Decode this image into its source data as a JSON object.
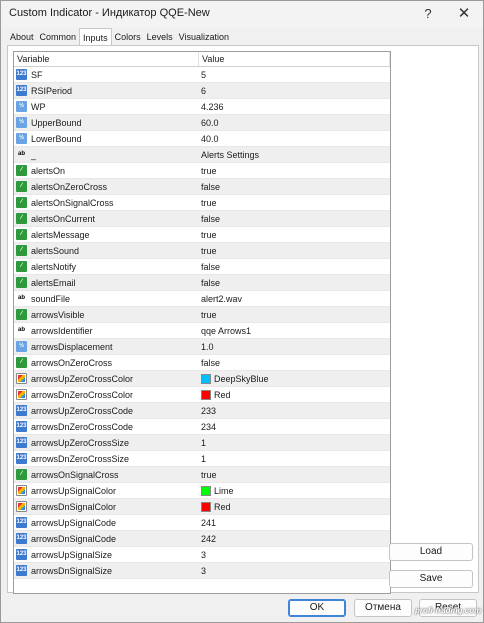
{
  "window": {
    "title": "Custom Indicator - Индикатор QQE-New",
    "help_label": "?",
    "close_label": "✕"
  },
  "tabs": [
    {
      "label": "About"
    },
    {
      "label": "Common"
    },
    {
      "label": "Inputs",
      "active": true
    },
    {
      "label": "Colors"
    },
    {
      "label": "Levels"
    },
    {
      "label": "Visualization"
    }
  ],
  "grid": {
    "headers": {
      "variable": "Variable",
      "value": "Value"
    },
    "rows": [
      {
        "name": "SF",
        "type": "int",
        "value": "5"
      },
      {
        "name": "RSIPeriod",
        "type": "int",
        "value": "6"
      },
      {
        "name": "WP",
        "type": "double",
        "value": "4.236"
      },
      {
        "name": "UpperBound",
        "type": "double",
        "value": "60.0"
      },
      {
        "name": "LowerBound",
        "type": "double",
        "value": "40.0"
      },
      {
        "name": "_",
        "type": "string",
        "value": "Alerts Settings"
      },
      {
        "name": "alertsOn",
        "type": "bool",
        "value": "true"
      },
      {
        "name": "alertsOnZeroCross",
        "type": "bool",
        "value": "false"
      },
      {
        "name": "alertsOnSignalCross",
        "type": "bool",
        "value": "true"
      },
      {
        "name": "alertsOnCurrent",
        "type": "bool",
        "value": "false"
      },
      {
        "name": "alertsMessage",
        "type": "bool",
        "value": "true"
      },
      {
        "name": "alertsSound",
        "type": "bool",
        "value": "true"
      },
      {
        "name": "alertsNotify",
        "type": "bool",
        "value": "false"
      },
      {
        "name": "alertsEmail",
        "type": "bool",
        "value": "false"
      },
      {
        "name": "soundFile",
        "type": "string",
        "value": "alert2.wav"
      },
      {
        "name": "arrowsVisible",
        "type": "bool",
        "value": "true"
      },
      {
        "name": "arrowsIdentifier",
        "type": "string",
        "value": "qqe Arrows1"
      },
      {
        "name": "arrowsDisplacement",
        "type": "double",
        "value": "1.0"
      },
      {
        "name": "arrowsOnZeroCross",
        "type": "bool",
        "value": "false"
      },
      {
        "name": "arrowsUpZeroCrossColor",
        "type": "color",
        "value": "DeepSkyBlue",
        "swatch": "#00bfff"
      },
      {
        "name": "arrowsDnZeroCrossColor",
        "type": "color",
        "value": "Red",
        "swatch": "#ff0000"
      },
      {
        "name": "arrowsUpZeroCrossCode",
        "type": "int",
        "value": "233"
      },
      {
        "name": "arrowsDnZeroCrossCode",
        "type": "int",
        "value": "234"
      },
      {
        "name": "arrowsUpZeroCrossSize",
        "type": "int",
        "value": "1"
      },
      {
        "name": "arrowsDnZeroCrossSize",
        "type": "int",
        "value": "1"
      },
      {
        "name": "arrowsOnSignalCross",
        "type": "bool",
        "value": "true"
      },
      {
        "name": "arrowsUpSignalColor",
        "type": "color",
        "value": "Lime",
        "swatch": "#00ff00"
      },
      {
        "name": "arrowsDnSignalColor",
        "type": "color",
        "value": "Red",
        "swatch": "#ff0000"
      },
      {
        "name": "arrowsUpSignalCode",
        "type": "int",
        "value": "241"
      },
      {
        "name": "arrowsDnSignalCode",
        "type": "int",
        "value": "242"
      },
      {
        "name": "arrowsUpSignalSize",
        "type": "int",
        "value": "3"
      },
      {
        "name": "arrowsDnSignalSize",
        "type": "int",
        "value": "3"
      }
    ]
  },
  "type_icons": {
    "int": {
      "glyph": "123",
      "icon": "integer-type-icon"
    },
    "double": {
      "glyph": "½",
      "icon": "double-type-icon"
    },
    "string": {
      "glyph": "ab",
      "icon": "string-type-icon"
    },
    "bool": {
      "glyph": "⁄",
      "icon": "boolean-type-icon"
    },
    "color": {
      "glyph": "",
      "icon": "color-type-icon"
    }
  },
  "buttons": {
    "load": "Load",
    "save": "Save",
    "ok": "OK",
    "cancel": "Отмена",
    "reset": "Reset"
  },
  "watermark": "profi-trading.com"
}
